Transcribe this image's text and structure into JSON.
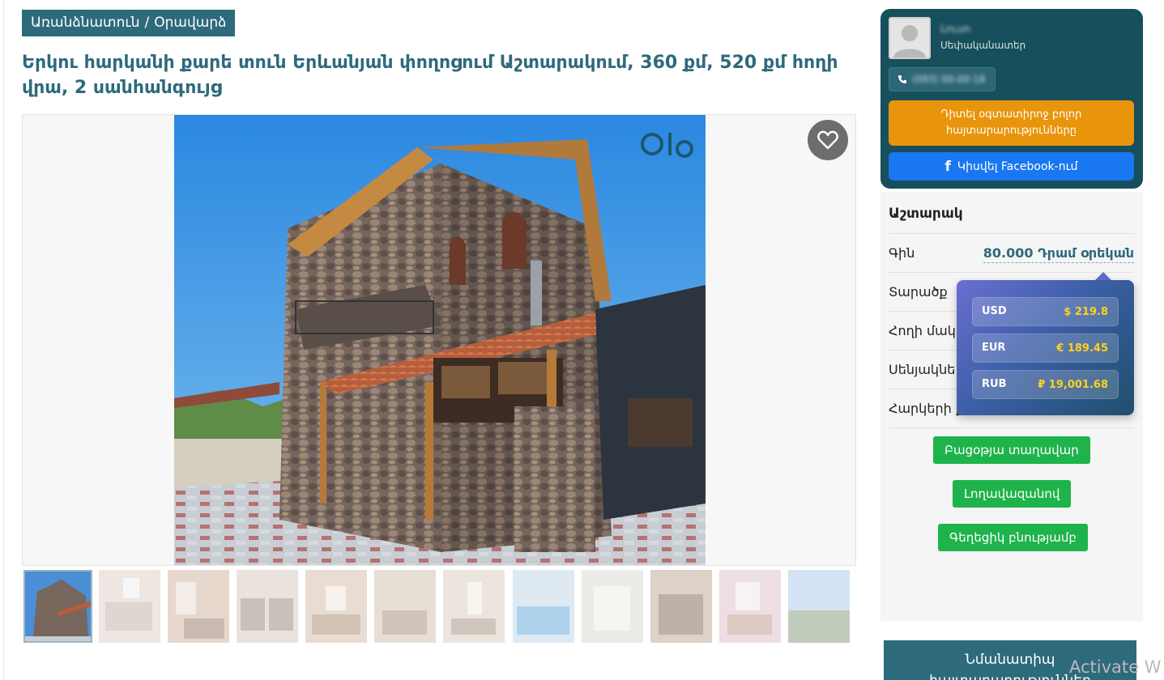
{
  "breadcrumb": {
    "home": "Առանձնատուն",
    "separator": "/",
    "current": "Օրավարձ"
  },
  "listing": {
    "title": "Երկու հարկանի քարե տուն Երևանյան փողոցում Աշտարակում, 360 քմ, 520 քմ հողի վրա, 2 սանհանգույց"
  },
  "gallery": {
    "favorite_icon": "heart-icon",
    "logo_text": "elo",
    "thumbnail_count": 12
  },
  "seller": {
    "name": "Լուսո",
    "role": "Սեփականատեր",
    "phone": "(093) 00-00-18",
    "all_ads_label": "Դիտել օգտատիրոջ բոլոր հայտարարությունները",
    "facebook_label": "Կիսվել Facebook-ում"
  },
  "details": {
    "location": "Աշտարակ",
    "rows": [
      {
        "label": "Գին",
        "value": "80.000 Դրամ օրեկան"
      },
      {
        "label": "Տարածք",
        "value": ""
      },
      {
        "label": "Հողի մակ",
        "value": ""
      },
      {
        "label": "Սենյակնե",
        "value": ""
      },
      {
        "label": "Հարկերի ք",
        "value": ""
      }
    ]
  },
  "actions": {
    "pool": "Բացօթյա տաղավար",
    "lake": "Լողավազանով",
    "nature": "Գեղեցիկ բնությամբ"
  },
  "currency": [
    {
      "code": "USD",
      "value": "$ 219.8"
    },
    {
      "code": "EUR",
      "value": "€ 189.45"
    },
    {
      "code": "RUB",
      "value": "₽ 19,001.68"
    }
  ],
  "similar": {
    "line1": "Նմանատիպ",
    "line2": "հայտարարություններ"
  },
  "os_watermark": "Activate W",
  "colors": {
    "accent": "#2d6a7c",
    "seller_bg": "#174f5c",
    "orange": "#e8950c",
    "facebook": "#1a77f2",
    "green": "#1fb34c",
    "currency_value": "#ffd21f"
  }
}
